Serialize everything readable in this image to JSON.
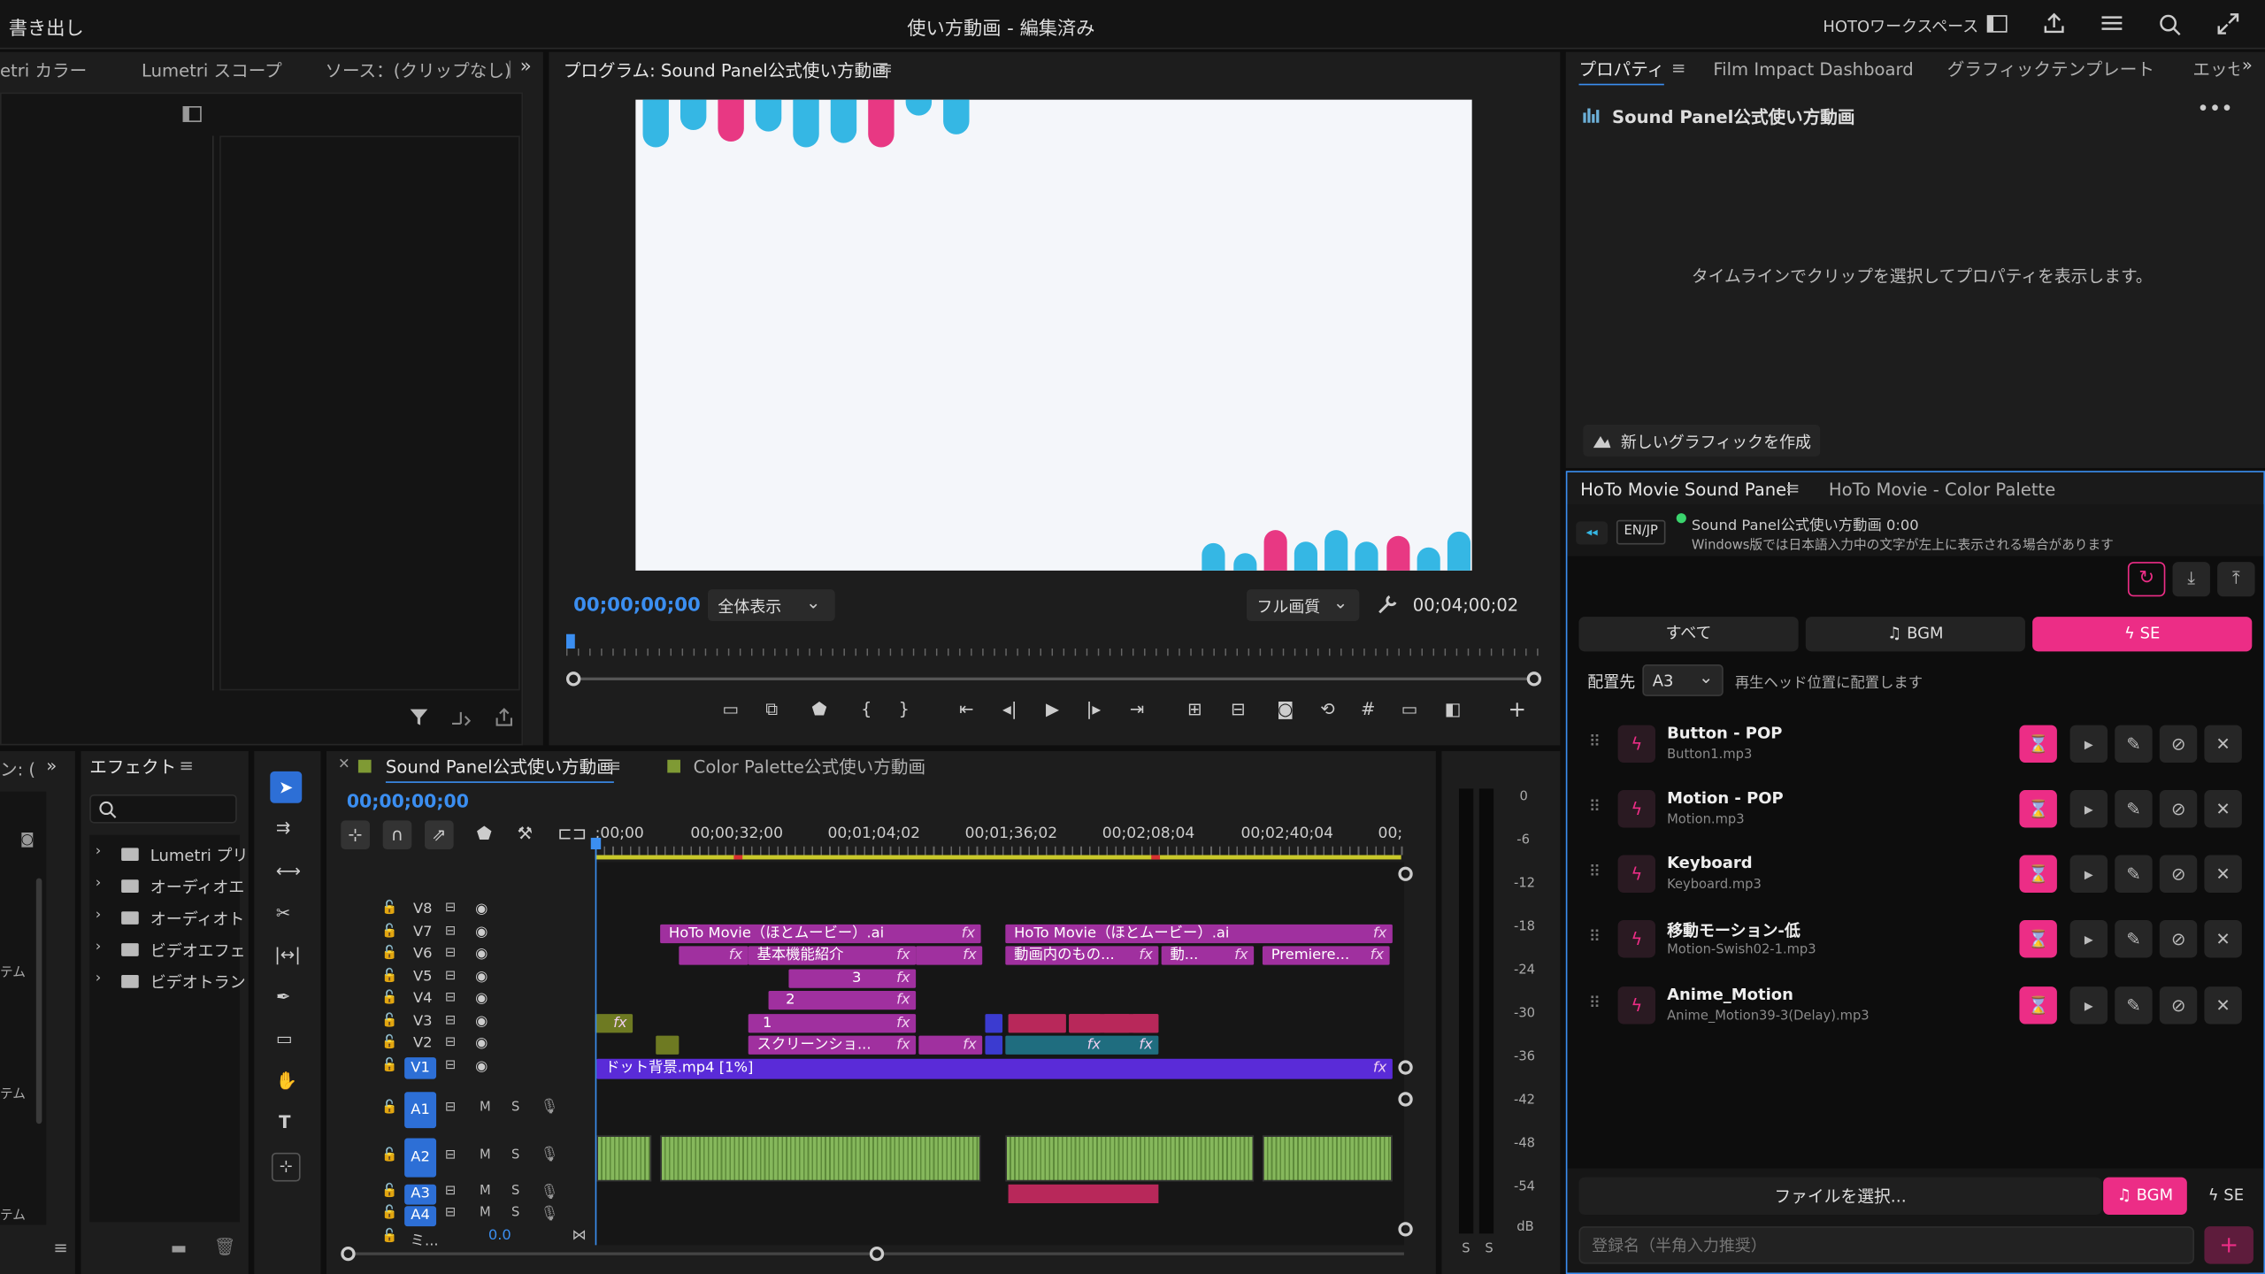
{
  "topbar": {
    "export": "書き出し",
    "title": "使い方動画 - 編集済み",
    "workspace": "HOTOワークスペース"
  },
  "left_tabs": [
    "etri カラー",
    "Lumetri スコープ",
    "ソース：(クリップなし)"
  ],
  "program": {
    "tab": "プログラム: Sound Panel公式使い方動画",
    "timecode_left": "00;00;00;00",
    "zoom": "全体表示",
    "quality": "フル画質",
    "timecode_right": "00;04;00;02"
  },
  "props": {
    "tabs": [
      "プロパティ",
      "Film Impact Dashboard",
      "グラフィックテンプレート",
      "エッセ"
    ],
    "seq_name": "Sound Panel公式使い方動画",
    "empty_msg": "タイムラインでクリップを選択してプロパティを表示します。",
    "new_graphic": "新しいグラフィックを作成"
  },
  "sound_panel": {
    "tabs": [
      "HoTo Movie Sound Panel",
      "HoTo Movie - Color Palette"
    ],
    "lang": "EN/JP",
    "status": "Sound Panel公式使い方動画 0:00",
    "note": "Windows版では日本語入力中の文字が左上に表示される場合があります",
    "filters": [
      "すべて",
      "BGM",
      "SE"
    ],
    "place_label": "配置先",
    "place_value": "A3",
    "place_desc": "再生ヘッド位置に配置します",
    "items": [
      {
        "title": "Button - POP",
        "file": "Button1.mp3"
      },
      {
        "title": "Motion - POP",
        "file": "Motion.mp3"
      },
      {
        "title": "Keyboard",
        "file": "Keyboard.mp3"
      },
      {
        "title": "移動モーション-低",
        "file": "Motion-Swish02-1.mp3"
      },
      {
        "title": "Anime_Motion",
        "file": "Anime_Motion39-3(Delay).mp3"
      }
    ],
    "file_select": "ファイルを選択...",
    "bgm": "BGM",
    "se": "SE",
    "name_placeholder": "登録名（半角入力推奨）"
  },
  "effects": {
    "left_tab": "ン: (",
    "tab": "エフェクト",
    "folders": [
      "Lumetri プリ",
      "オーディオエ",
      "オーディオト",
      "ビデオエフェ",
      "ビデオトラン"
    ],
    "side_labels": [
      "テム",
      "テム",
      "テム"
    ]
  },
  "timeline": {
    "tabs": [
      "Sound Panel公式使い方動画",
      "Color Palette公式使い方動画"
    ],
    "timecode": "00;00;00;00",
    "ruler": [
      ";00;00",
      "00;00;32;00",
      "00;01;04;02",
      "00;01;36;02",
      "00;02;08;04",
      "00;02;40;04",
      "00;"
    ],
    "video_tracks": [
      "V8",
      "V7",
      "V6",
      "V5",
      "V4",
      "V3",
      "V2",
      "V1"
    ],
    "audio_tracks": [
      "A1",
      "A2",
      "A3",
      "A4"
    ],
    "master": "ミ...",
    "master_val": "0.0",
    "clips": {
      "v7a": "HoTo Movie（ほとムービー）.ai",
      "v7b": "HoTo Movie（ほとムービー）.ai",
      "v6a": "基本機能紹介",
      "v6b": "動画内のもの...",
      "v6c": "動...",
      "v6d": "Premiere...",
      "v5": "3",
      "v4": "2",
      "v3": "1",
      "v2": "スクリーンショ...",
      "v1": "ドット背景.mp4 [1%]"
    }
  },
  "meter": {
    "scale": [
      "0",
      "-6",
      "-12",
      "-18",
      "-24",
      "-30",
      "-36",
      "-42",
      "-48",
      "-54",
      "dB"
    ],
    "solo": [
      "S",
      "S"
    ]
  },
  "colors": {
    "accent_pink": "#ec2d86",
    "accent_blue": "#2d8ceb",
    "clip_magenta": "#a0309f",
    "clip_v1": "#5a2bd8",
    "audio_green": "#86b85c"
  }
}
